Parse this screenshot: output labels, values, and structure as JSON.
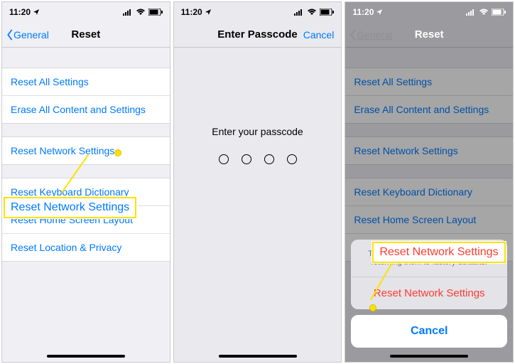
{
  "status": {
    "time": "11:20",
    "loc_icon": "location",
    "signal": "signal",
    "wifi": "wifi",
    "battery": "battery"
  },
  "nav": {
    "back_general": "General",
    "title_reset": "Reset",
    "title_passcode": "Enter Passcode",
    "cancel": "Cancel"
  },
  "reset_rows": {
    "g1": [
      "Reset All Settings",
      "Erase All Content and Settings"
    ],
    "g2": [
      "Reset Network Settings"
    ],
    "g3": [
      "Reset Keyboard Dictionary",
      "Reset Home Screen Layout",
      "Reset Location & Privacy"
    ]
  },
  "passcode": {
    "prompt": "Enter your passcode"
  },
  "sheet": {
    "message": "This will delete all network settings, returning them to factory defaults.",
    "action": "Reset Network Settings",
    "cancel": "Cancel"
  },
  "callouts": {
    "c1": "Reset Network Settings",
    "c2": "Reset Network Settings"
  }
}
